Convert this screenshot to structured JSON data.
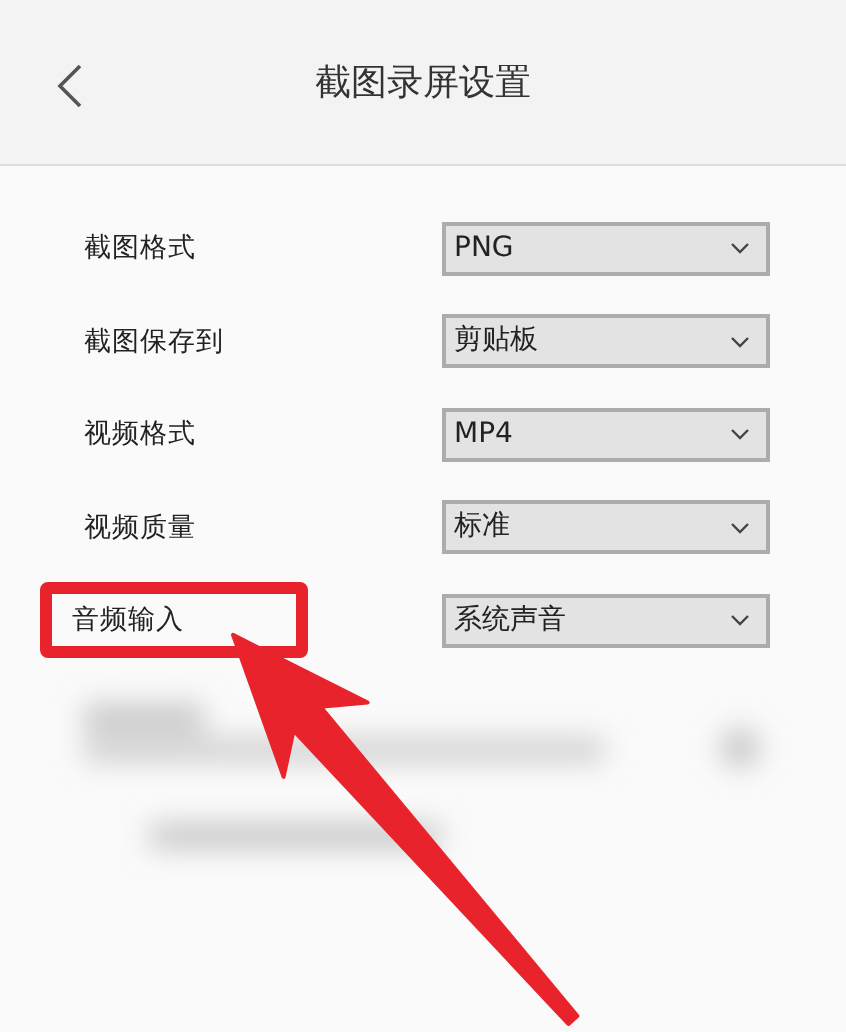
{
  "header": {
    "title": "截图录屏设置"
  },
  "settings": [
    {
      "label": "截图格式",
      "value": "PNG",
      "highlighted": false
    },
    {
      "label": "截图保存到",
      "value": "剪贴板",
      "highlighted": false
    },
    {
      "label": "视频格式",
      "value": "MP4",
      "highlighted": false
    },
    {
      "label": "视频质量",
      "value": "标准",
      "highlighted": false
    },
    {
      "label": "音频输入",
      "value": "系统声音",
      "highlighted": true
    }
  ]
}
